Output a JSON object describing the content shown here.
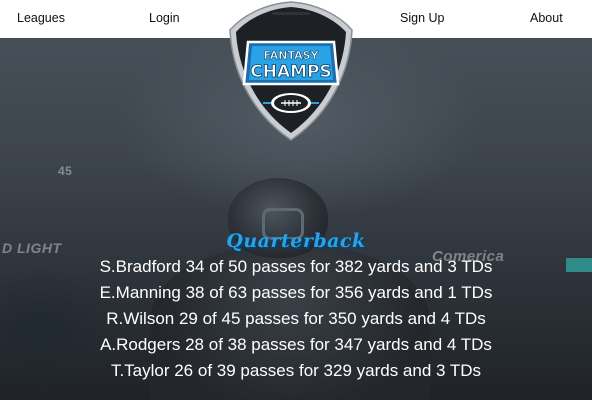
{
  "nav": {
    "leagues": "Leagues",
    "login": "Login",
    "signup": "Sign Up",
    "about": "About"
  },
  "logo": {
    "line1": "FANTASY",
    "line2": "CHAMPS"
  },
  "background": {
    "ad_left": "D LIGHT",
    "ad_right": "Comerica",
    "number": "45"
  },
  "stats": {
    "title": "Quarterback",
    "lines": [
      "S.Bradford 34 of 50 passes for 382 yards and 3 TDs",
      "E.Manning 38 of 63 passes for 356 yards and 1 TDs",
      "R.Wilson 29 of 45 passes for 350 yards and 4 TDs",
      "A.Rodgers 28 of 38 passes for 347 yards and 4 TDs",
      "T.Taylor 26 of 39 passes for 329 yards and 3 TDs"
    ]
  },
  "colors": {
    "accent": "#2aa2e6",
    "shield_dark": "#1d2024",
    "nav_bg": "#ffffff"
  }
}
